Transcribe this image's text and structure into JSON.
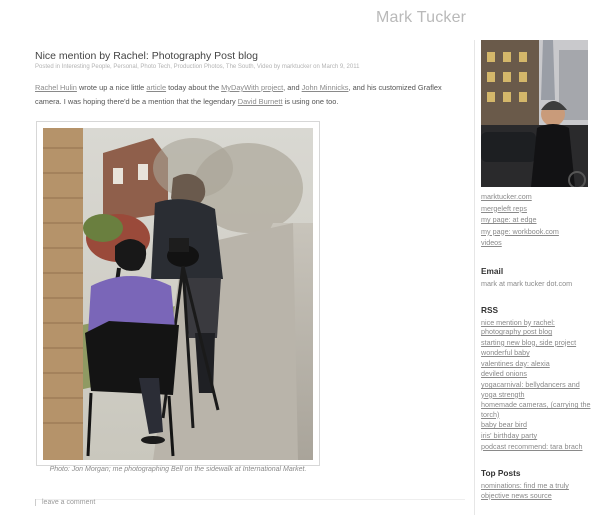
{
  "site": {
    "title": "Mark Tucker"
  },
  "post": {
    "title": "Nice mention by Rachel: Photography Post blog",
    "meta": "Posted in Interesting People, Personal, Photo Tech, Production Photos, The South, Video by marktucker on March 9, 2011",
    "body": {
      "rachel_link": "Rachel Hulin",
      "t1": " wrote up a nice little ",
      "article_link": "article",
      "t2": " today about the ",
      "mydaywith_link": "MyDayWith project",
      "t3": ", and ",
      "minnicks_link": "John Minnicks",
      "t4": ", and his customized Graflex camera. I was hoping there'd be a mention that the legendary ",
      "burnett_link": "David Burnett",
      "t5": " is using one too."
    },
    "caption": "Photo: Jon Morgan; me photographing Bell on the sidewalk at International Market.",
    "comment_link": "leave a comment"
  },
  "sidebar": {
    "links": [
      "marktucker.com",
      "mergeleft reps",
      "my page: at edge",
      "my page: workbook.com",
      "videos"
    ],
    "email_heading": "Email",
    "email_text": "mark at mark tucker dot.com",
    "rss_heading": "RSS",
    "rss_items": [
      "nice mention by rachel: photography post blog",
      "starting new blog, side project",
      "wonderful baby",
      "valentines day: alexia",
      "deviled onions",
      "yogacarnival: bellydancers and yoga strength",
      "homemade cameras, (carrying the torch)",
      "baby bear bird",
      "iris' birthday party",
      "podcast recommend: tara brach"
    ],
    "top_posts_heading": "Top Posts",
    "top_posts": [
      "nominations: find me a truly objective news source"
    ]
  }
}
